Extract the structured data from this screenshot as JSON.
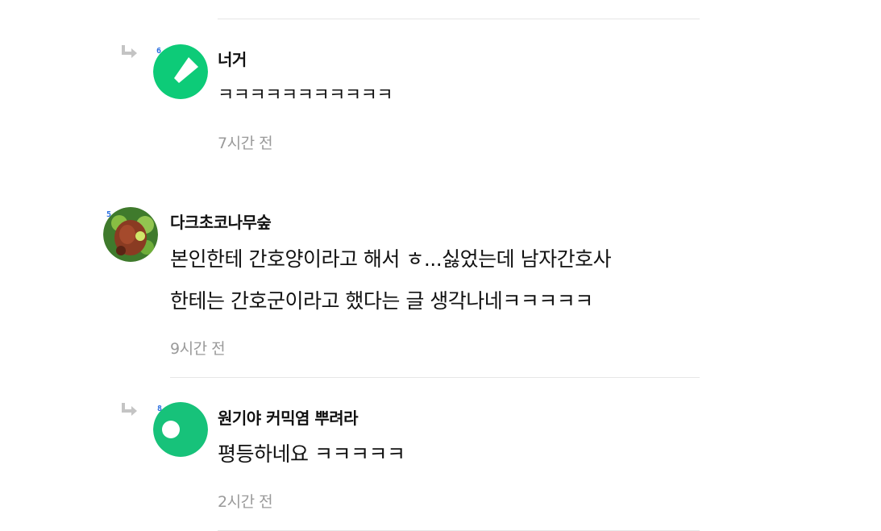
{
  "comments": [
    {
      "type": "reply",
      "level": "6",
      "nickname": "너거",
      "text": "ㅋㅋㅋㅋㅋㅋㅋㅋㅋㅋㅋ",
      "time": "7시간 전",
      "avatar_color": "#0dcb78"
    },
    {
      "type": "comment",
      "level": "5",
      "nickname": "다크초코나무숲",
      "text_lines": [
        "본인한테 간호양이라고 해서 ㅎ...싫었는데 남자간호사",
        "한테는 간호군이라고 했다는 글 생각나네ㅋㅋㅋㅋㅋ"
      ],
      "time": "9시간 전"
    },
    {
      "type": "reply",
      "level": "8",
      "nickname": "원기야 커믹염 뿌려라",
      "text": "평등하네요 ㅋㅋㅋㅋㅋ",
      "time": "2시간 전",
      "avatar_color": "#17c27a"
    }
  ],
  "colors": {
    "level_badge": "#2b6fe0",
    "timestamp": "#9a9a9a",
    "divider": "#e6e6e6",
    "reply_arrow": "#c4c4c4"
  }
}
